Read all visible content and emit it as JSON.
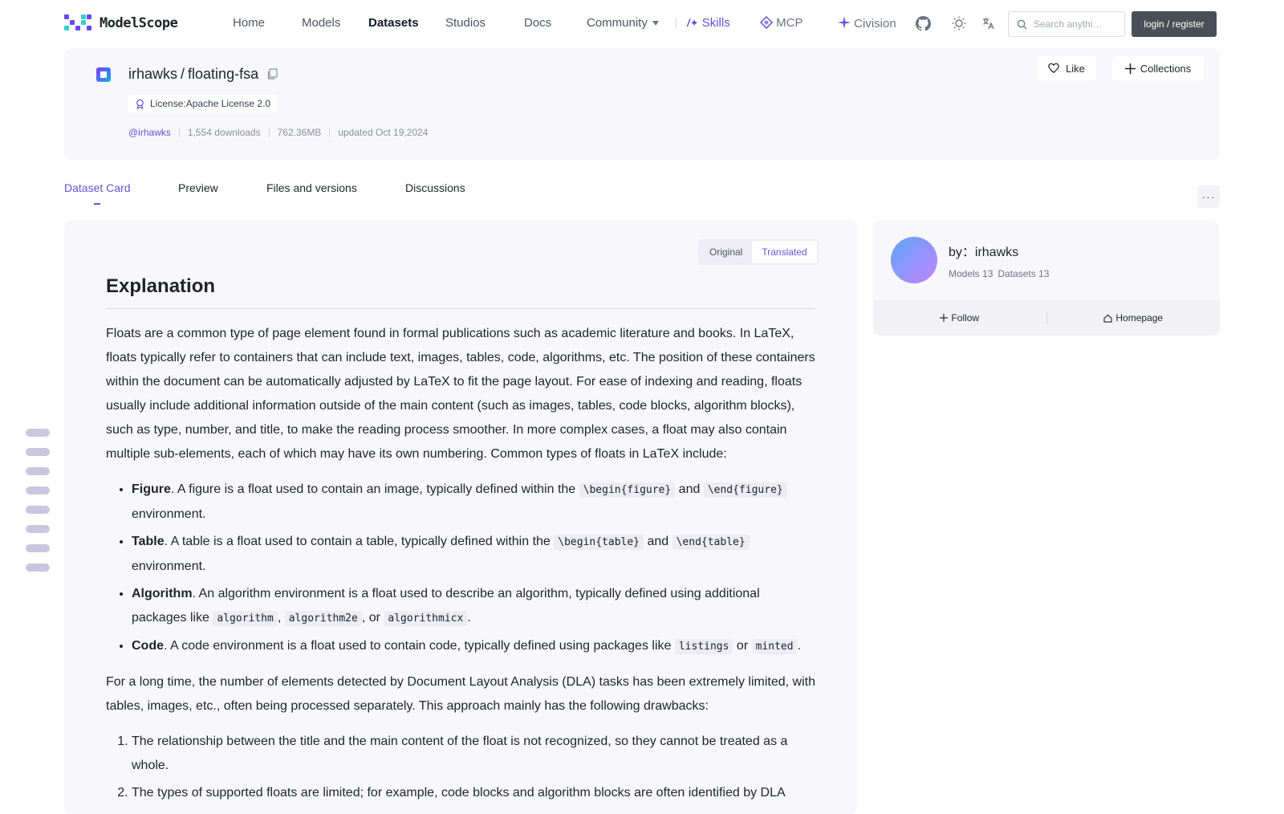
{
  "nav": {
    "logo_text": "ModelScope",
    "items": [
      "Home",
      "Models",
      "Datasets",
      "Studios",
      "Docs",
      "Community"
    ],
    "skills": "Skills",
    "mcp": "MCP",
    "civision": "Civision",
    "search_placeholder": "Search anythi…",
    "login": "login / register",
    "colors": {
      "accent": "#6750d8",
      "login_bg": "#4a4f57"
    }
  },
  "repo": {
    "owner": "irhawks",
    "slash": "/",
    "name": "floating-fsa",
    "license": "License:Apache License 2.0",
    "owner_handle": "@irhawks",
    "downloads": "1,554 downloads",
    "size": "762.36MB",
    "updated": "updated Oct 19,2024",
    "like": "Like",
    "collections": "Collections"
  },
  "tabs": [
    "Dataset Card",
    "Preview",
    "Files and versions",
    "Discussions"
  ],
  "more": "···",
  "toggle": {
    "original": "Original",
    "translated": "Translated"
  },
  "doc": {
    "heading": "Explanation",
    "p1": "Floats are a common type of page element found in formal publications such as academic literature and books. In LaTeX, floats typically refer to containers that can include text, images, tables, code, algorithms, etc. The position of these containers within the document can be automatically adjusted by LaTeX to fit the page layout. For ease of indexing and reading, floats usually include additional information outside of the main content (such as images, tables, code blocks, algorithm blocks), such as type, number, and title, to make the reading process smoother. In more complex cases, a float may also contain multiple sub-elements, each of which may have its own numbering. Common types of floats in LaTeX include:",
    "figure": {
      "term": "Figure",
      "t1": ". A figure is a float used to contain an image, typically defined within the ",
      "c1": "\\begin{figure}",
      "t2": " and ",
      "c2": "\\end{figure}",
      "t3": " environment."
    },
    "table": {
      "term": "Table",
      "t1": ". A table is a float used to contain a table, typically defined within the ",
      "c1": "\\begin{table}",
      "t2": " and ",
      "c2": "\\end{table}",
      "t3": " environment."
    },
    "algorithm": {
      "term": "Algorithm",
      "t1": ". An algorithm environment is a float used to describe an algorithm, typically defined using additional packages like ",
      "c1": "algorithm",
      "t2": ", ",
      "c2": "algorithm2e",
      "t3": ", or ",
      "c3": "algorithmicx",
      "t4": "."
    },
    "code": {
      "term": "Code",
      "t1": ". A code environment is a float used to contain code, typically defined using packages like ",
      "c1": "listings",
      "t2": " or ",
      "c2": "minted",
      "t3": "."
    },
    "p2": "For a long time, the number of elements detected by Document Layout Analysis (DLA) tasks has been extremely limited, with tables, images, etc., often being processed separately. This approach mainly has the following drawbacks:",
    "ol1": "The relationship between the title and the main content of the float is not recognized, so they cannot be treated as a whole.",
    "ol2": "The types of supported floats are limited; for example, code blocks and algorithm blocks are often identified by DLA"
  },
  "author": {
    "name": "by：irhawks",
    "models": "Models 13",
    "datasets": "Datasets 13",
    "follow": "Follow",
    "homepage": "Homepage"
  }
}
